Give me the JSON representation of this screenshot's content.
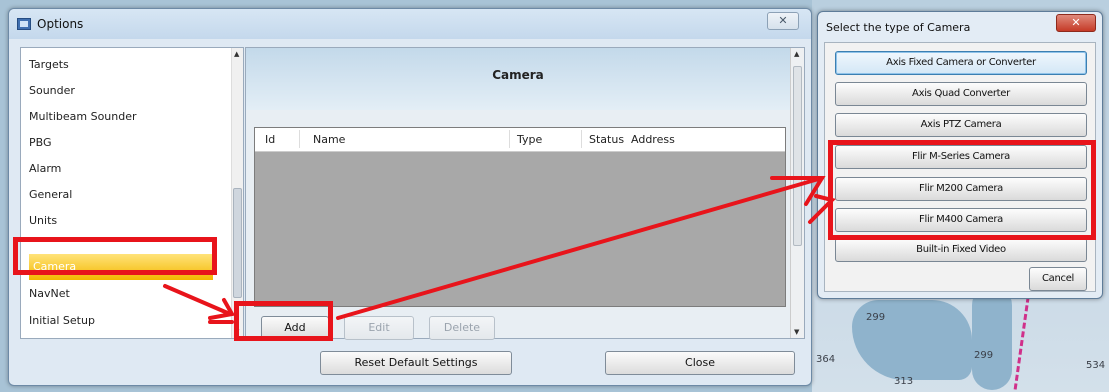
{
  "options_window": {
    "title": "Options",
    "close_glyph": "✕",
    "sidebar": {
      "items": [
        {
          "label": "Targets"
        },
        {
          "label": "Sounder"
        },
        {
          "label": "Multibeam Sounder"
        },
        {
          "label": "PBG"
        },
        {
          "label": "Alarm"
        },
        {
          "label": "General"
        },
        {
          "label": "Units"
        },
        {
          "label": "Camera"
        },
        {
          "label": "NavNet"
        },
        {
          "label": "Initial Setup"
        }
      ],
      "selected": "Camera"
    },
    "content": {
      "title": "Camera",
      "columns": [
        "Id",
        "Name",
        "Type",
        "Status",
        "Address"
      ],
      "buttons": {
        "add": "Add",
        "edit": "Edit",
        "delete": "Delete"
      }
    },
    "footer": {
      "reset": "Reset Default Settings",
      "close": "Close"
    }
  },
  "camera_dialog": {
    "title": "Select the type of Camera",
    "close_glyph": "✕",
    "options": [
      "Axis Fixed Camera or Converter",
      "Axis Quad Converter",
      "Axis PTZ Camera",
      "Flir M-Series Camera",
      "Flir M200 Camera",
      "Flir M400 Camera",
      "Built-in Fixed Video"
    ],
    "cancel": "Cancel"
  },
  "chart_depths": [
    "299",
    "299",
    "364",
    "313",
    "534"
  ],
  "colors": {
    "highlight": "#e8141b",
    "selection": "#f3b800"
  },
  "icons": [
    "app-icon",
    "close-icon",
    "scroll-up-icon",
    "scroll-down-icon"
  ]
}
